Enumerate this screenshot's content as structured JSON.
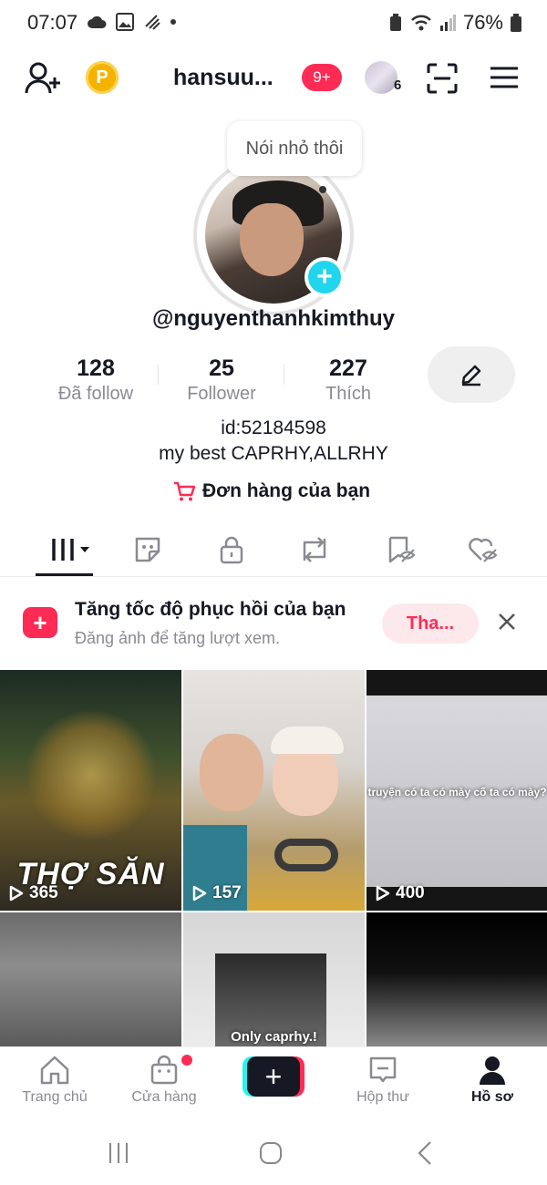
{
  "status_bar": {
    "time": "07:07",
    "battery": "76%"
  },
  "top_bar": {
    "username": "hansuu...",
    "notifications_badge": "9+",
    "friends_count": "6",
    "coin_label": "P"
  },
  "profile": {
    "note_bubble": "Nói nhỏ thôi",
    "handle": "@nguyenthanhkimthuy",
    "stats": [
      {
        "value": "128",
        "label": "Đã follow"
      },
      {
        "value": "25",
        "label": "Follower"
      },
      {
        "value": "227",
        "label": "Thích"
      }
    ],
    "id_text": "id:52184598",
    "bio": "my best CAPRHY,ALLRHY",
    "orders_label": "Đơn hàng của bạn"
  },
  "tabs": [
    "videos",
    "stickers",
    "private",
    "reposts",
    "saved",
    "liked"
  ],
  "promo": {
    "title": "Tăng tốc độ phục hồi của bạn",
    "subtitle": "Đăng ảnh để tăng lượt xem.",
    "button": "Tha..."
  },
  "videos": [
    {
      "views": "365",
      "caption": "THỢ SĂN"
    },
    {
      "views": "157",
      "caption": ""
    },
    {
      "views": "400",
      "caption": "truyện có ta có mày cố ta có mày?"
    },
    {
      "views": "",
      "caption": ""
    },
    {
      "views": "",
      "caption": "Only caprhy.!"
    },
    {
      "views": "",
      "caption": ""
    }
  ],
  "bottom_nav": {
    "home": "Trang chủ",
    "shop": "Cửa hàng",
    "inbox": "Hộp thư",
    "profile": "Hồ sơ"
  },
  "colors": {
    "accent": "#fe2c55",
    "cyan": "#25f4ee",
    "text": "#161823",
    "muted": "#8a8b91"
  }
}
